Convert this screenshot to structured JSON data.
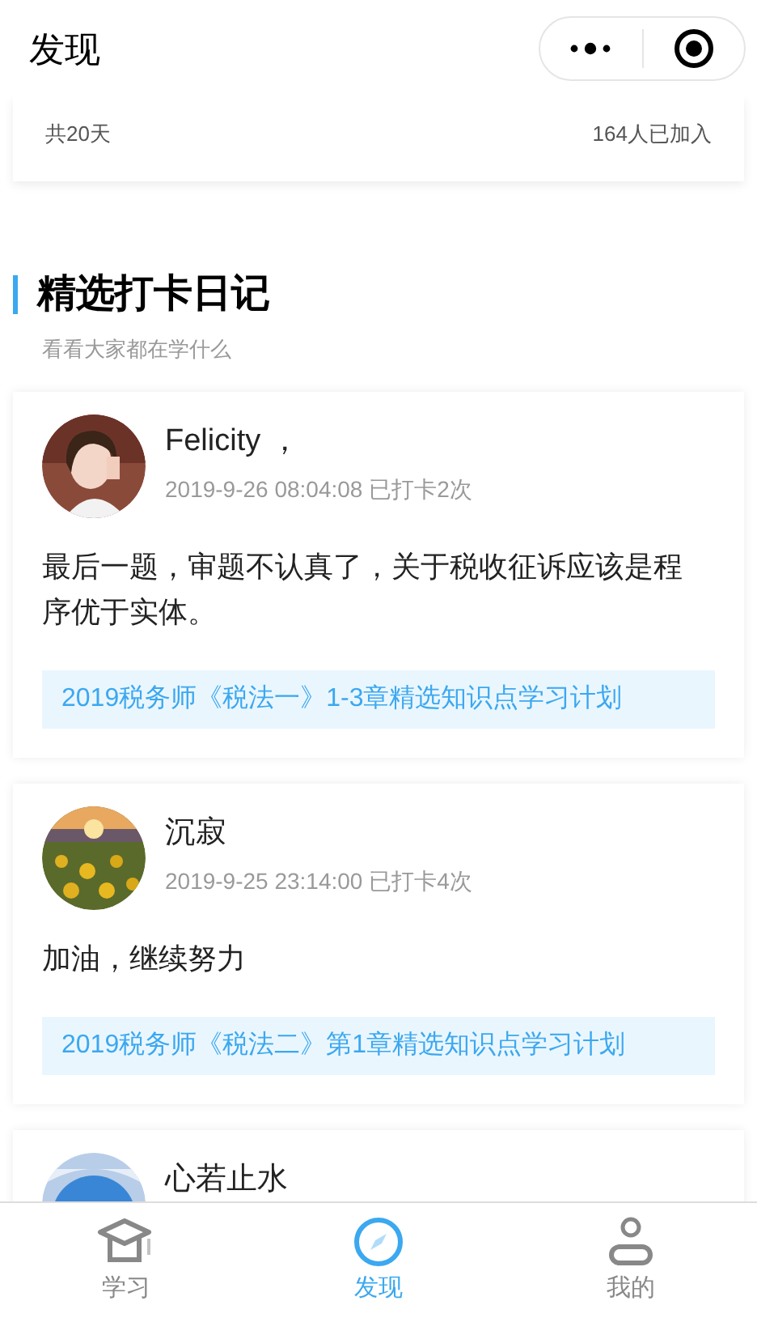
{
  "header": {
    "title": "发现"
  },
  "plan_card": {
    "duration": "共20天",
    "joined": "164人已加入"
  },
  "section": {
    "title": "精选打卡日记",
    "subtitle": "看看大家都在学什么"
  },
  "diaries": [
    {
      "name": "Felicity ，",
      "meta": "2019-9-26 08:04:08 已打卡2次",
      "text": "最后一题，审题不认真了，关于税收征诉应该是程序优于实体。",
      "plan": "2019税务师《税法一》1-3章精选知识点学习计划"
    },
    {
      "name": "沉寂",
      "meta": "2019-9-25 23:14:00 已打卡4次",
      "text": "加油，继续努力",
      "plan": "2019税务师《税法二》第1章精选知识点学习计划"
    },
    {
      "name": "心若止水"
    }
  ],
  "tabs": [
    {
      "label": "学习",
      "selected": false
    },
    {
      "label": "发现",
      "selected": true
    },
    {
      "label": "我的",
      "selected": false
    }
  ]
}
